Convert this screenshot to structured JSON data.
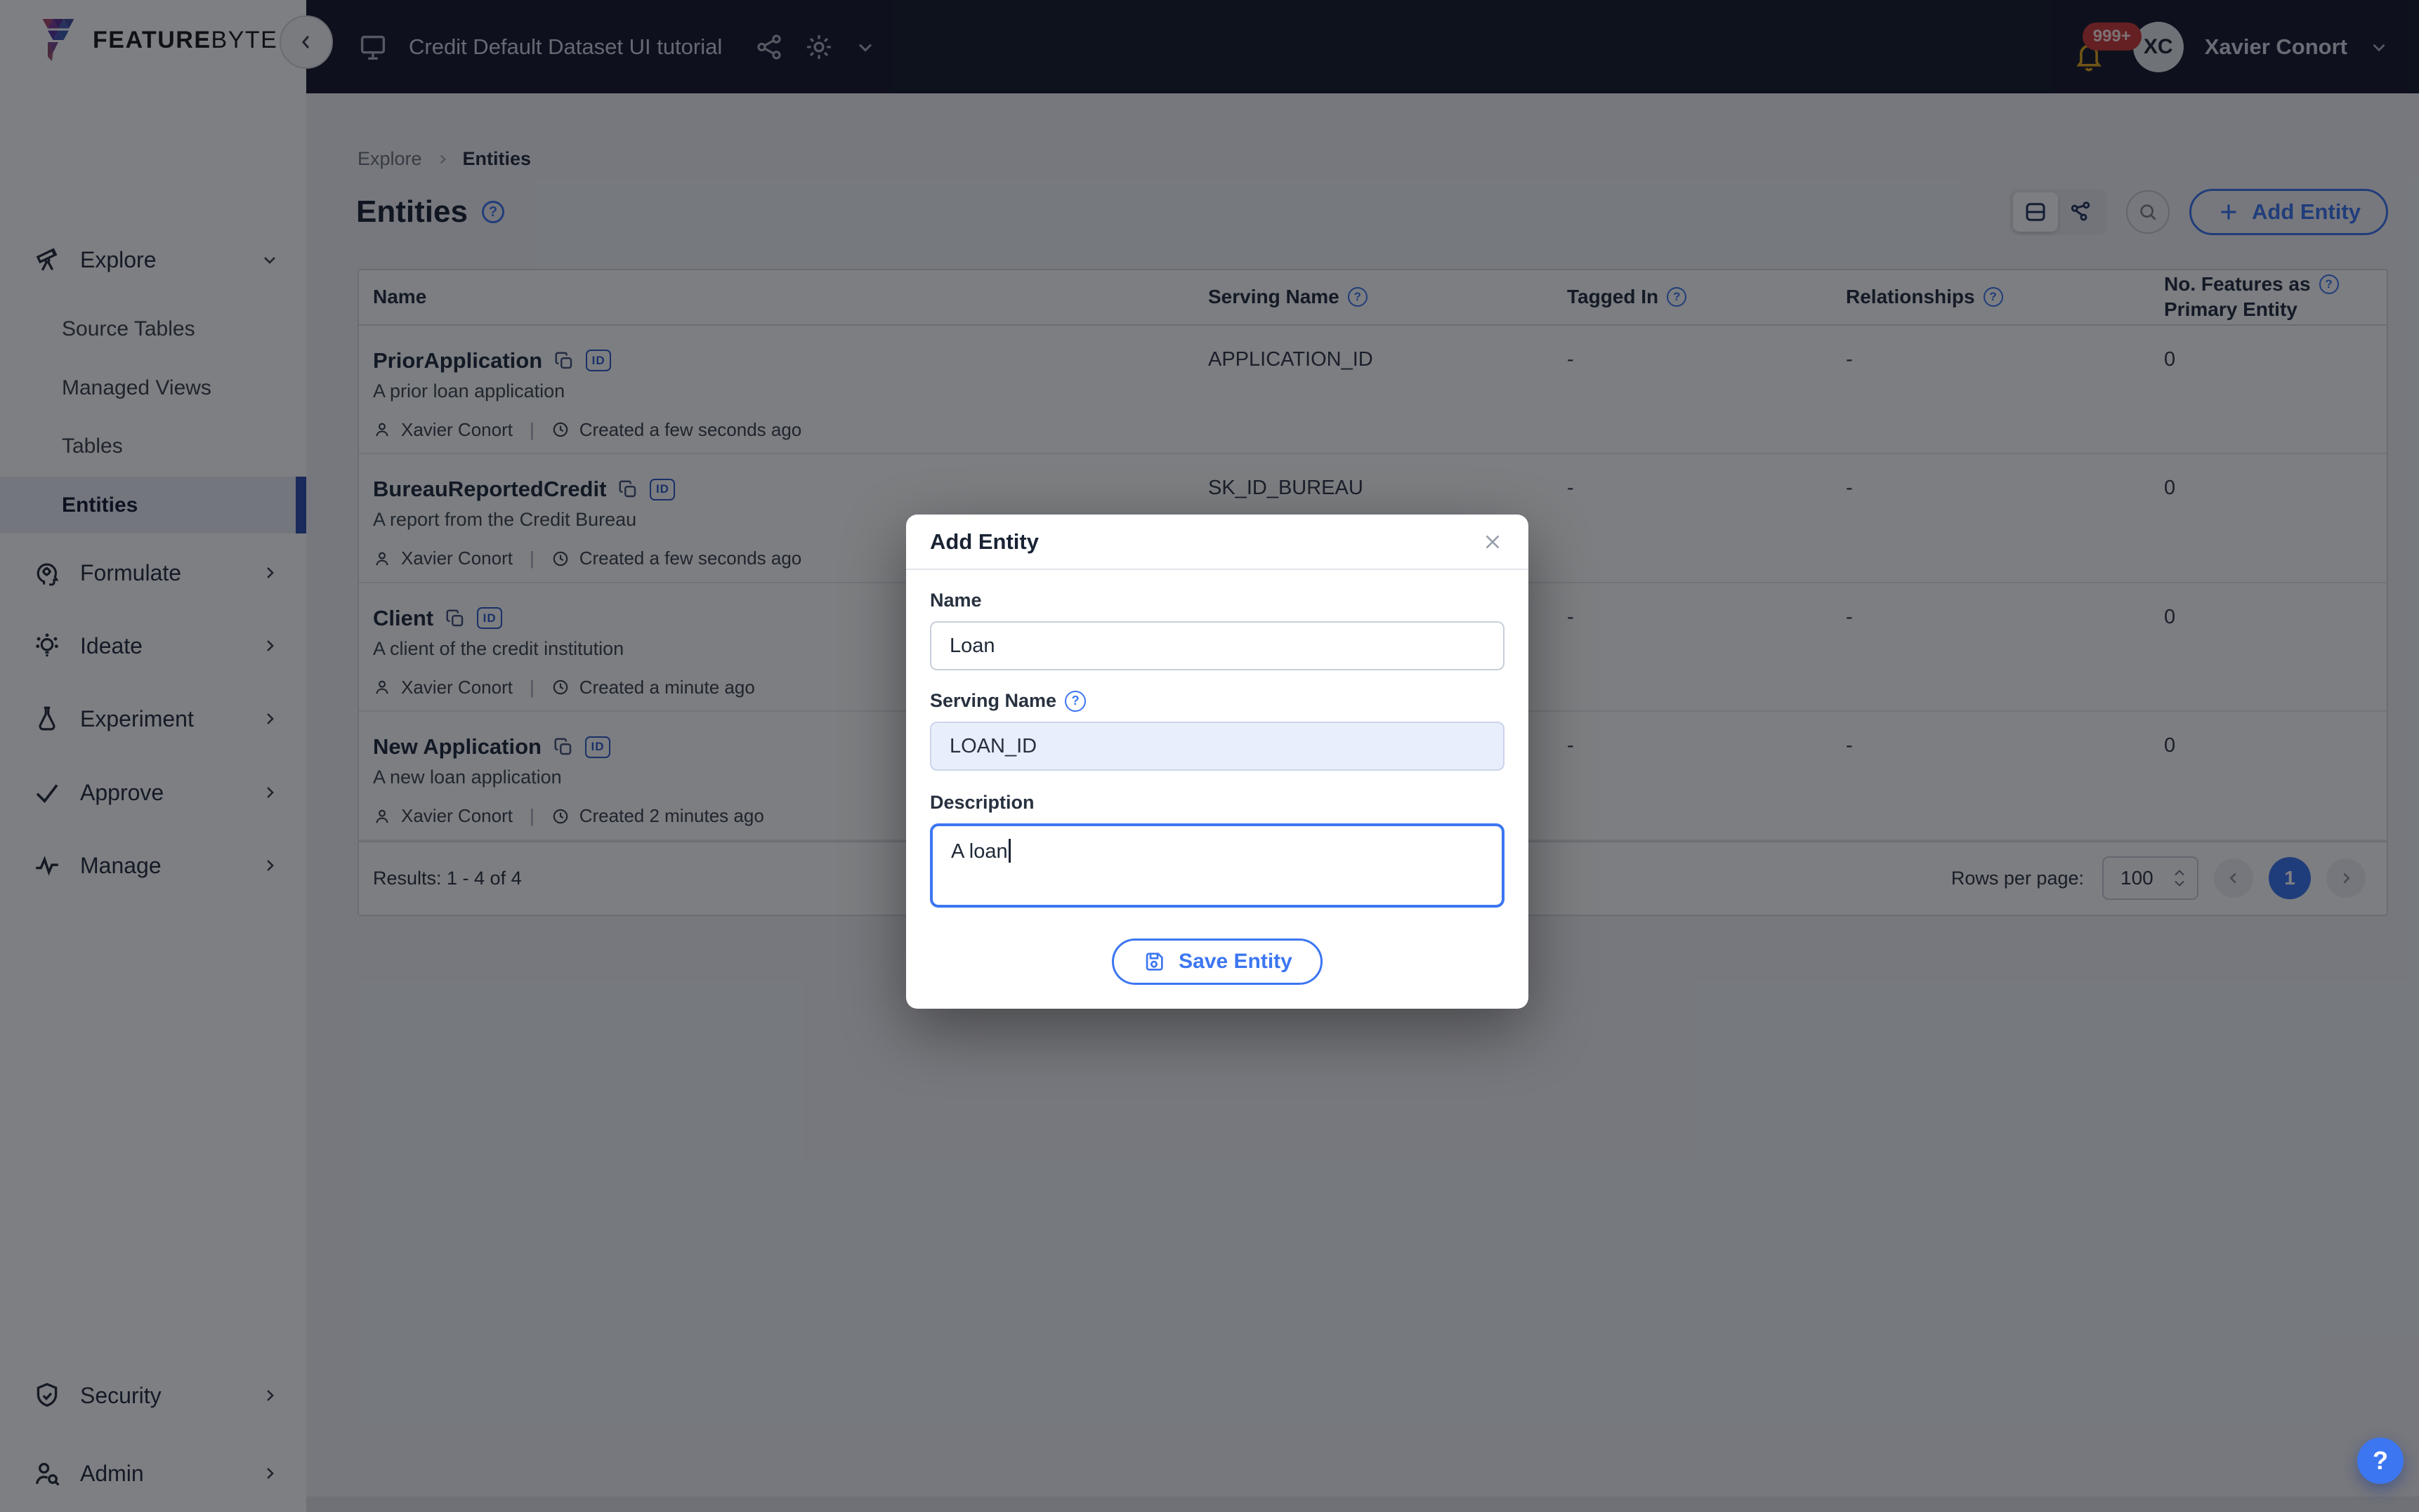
{
  "colors": {
    "accent": "#3c76f1",
    "accent-deep": "#2f5cc9",
    "topbar-bg": "#151b2c",
    "sidebar-active-border": "#2e4fae",
    "badge-red": "#c93a3a",
    "bell-yellow": "#e2a71f",
    "page-bg": "#f0f1f4"
  },
  "brand": {
    "word_bold": "FEATURE",
    "word_light": "BYTE"
  },
  "topbar": {
    "project_title": "Credit Default Dataset UI tutorial",
    "notification_badge": "999+",
    "user_initials": "XC",
    "user_name": "Xavier Conort"
  },
  "sidebar": {
    "groups": [
      {
        "label": "Explore"
      },
      {
        "label": "Formulate"
      },
      {
        "label": "Ideate"
      },
      {
        "label": "Experiment"
      },
      {
        "label": "Approve"
      },
      {
        "label": "Manage"
      }
    ],
    "explore_children": [
      {
        "label": "Source Tables"
      },
      {
        "label": "Managed Views"
      },
      {
        "label": "Tables"
      },
      {
        "label": "Entities"
      }
    ],
    "bottom_groups": [
      {
        "label": "Security"
      },
      {
        "label": "Admin"
      }
    ]
  },
  "breadcrumb": {
    "parent": "Explore",
    "current": "Entities"
  },
  "page": {
    "title": "Entities"
  },
  "toolbar": {
    "add_entity_label": "Add Entity"
  },
  "table": {
    "headers": {
      "name": "Name",
      "serving_name": "Serving Name",
      "tagged_in": "Tagged In",
      "relationships": "Relationships",
      "features_line1": "No. Features as",
      "features_line2": "Primary Entity"
    },
    "rows": [
      {
        "name": "PriorApplication",
        "description": "A prior loan application",
        "author": "Xavier Conort",
        "created": "Created a few seconds ago",
        "serving_name": "APPLICATION_ID",
        "tagged_in": "-",
        "relationships": "-",
        "features": "0"
      },
      {
        "name": "BureauReportedCredit",
        "description": "A report from the Credit Bureau",
        "author": "Xavier Conort",
        "created": "Created a few seconds ago",
        "serving_name": "SK_ID_BUREAU",
        "tagged_in": "-",
        "relationships": "-",
        "features": "0"
      },
      {
        "name": "Client",
        "description": "A client of the credit institution",
        "author": "Xavier Conort",
        "created": "Created a minute ago",
        "serving_name": "",
        "tagged_in": "-",
        "relationships": "-",
        "features": "0"
      },
      {
        "name": "New Application",
        "description": "A new loan application",
        "author": "Xavier Conort",
        "created": "Created 2 minutes ago",
        "serving_name": "",
        "tagged_in": "-",
        "relationships": "-",
        "features": "0"
      }
    ],
    "footer": {
      "results": "Results: 1 - 4 of 4",
      "rows_per_page_label": "Rows per page:",
      "rows_per_page_value": "100",
      "page": "1"
    }
  },
  "modal": {
    "title": "Add Entity",
    "name_label": "Name",
    "name_value": "Loan",
    "serving_label": "Serving Name",
    "serving_value": "LOAN_ID",
    "description_label": "Description",
    "description_value": "A loan",
    "save_label": "Save Entity"
  },
  "fab": {
    "help": "?"
  },
  "icons": {
    "id_label": "ID",
    "question": "?"
  }
}
